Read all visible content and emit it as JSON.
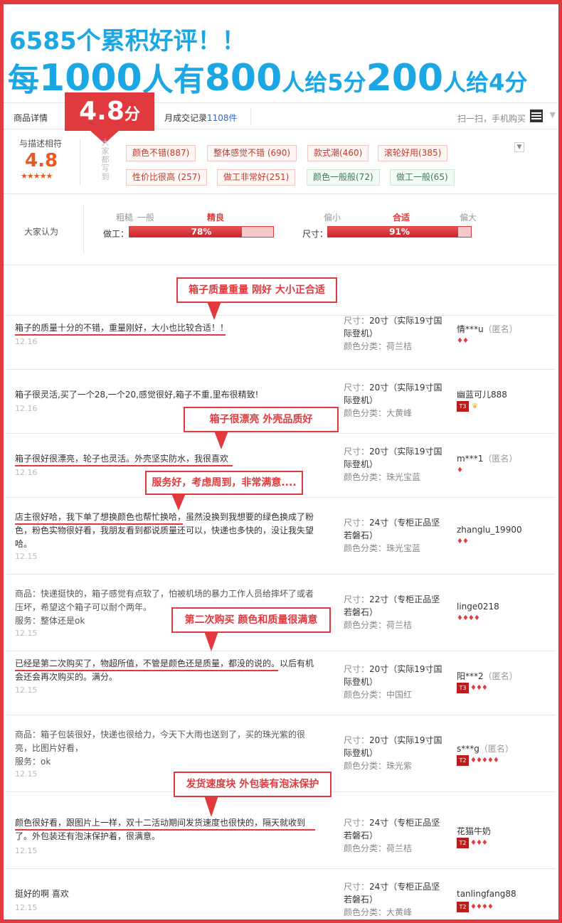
{
  "headline": {
    "line1": "6585个累积好评！！",
    "line2_a": "每",
    "line2_b": "1000",
    "line2_c": "人有",
    "line2_d": "800",
    "line2_e": "人给5分",
    "line2_f": "200",
    "line2_g": "人给4分"
  },
  "callout": {
    "value": "4.8",
    "unit": "分"
  },
  "tabs": {
    "detail": "商品详情",
    "record_label": "月成交记录",
    "record_count": "1108件",
    "scan": "扫一扫，手机购买"
  },
  "summary": {
    "label": "与描述相符",
    "score": "4.8",
    "stars": "★★★★★",
    "vertical_label": "大家都写到",
    "tags": [
      {
        "text": "颜色不错(887)",
        "tone": "red"
      },
      {
        "text": "整体感觉不错 (690)",
        "tone": "red"
      },
      {
        "text": "款式潮(460)",
        "tone": "red"
      },
      {
        "text": "滚轮好用(385)",
        "tone": "red"
      },
      {
        "text": "性价比很高 (257)",
        "tone": "red"
      },
      {
        "text": "做工非常好(251)",
        "tone": "red"
      },
      {
        "text": "颜色一般般(72)",
        "tone": "green"
      },
      {
        "text": "做工一般(65)",
        "tone": "green"
      }
    ]
  },
  "opinion": {
    "label": "大家认为",
    "workmanship": {
      "title": "做工：",
      "levels": [
        "粗糙",
        "一般",
        "精良"
      ],
      "active_level": "精良",
      "percent": 78,
      "percent_text": "78%"
    },
    "size": {
      "title": "尺寸：",
      "levels": [
        "偏小",
        "合适",
        "偏大"
      ],
      "active_level": "合适",
      "percent": 91,
      "percent_text": "91%"
    }
  },
  "notes": [
    {
      "text": "箱子质量重量 刚好 大小正合适"
    },
    {
      "text": "箱子很漂亮 外壳品质好"
    },
    {
      "text": "服务好，考虑周到，非常满意...."
    },
    {
      "text": "第二次购买  颜色和质量很满意"
    },
    {
      "text": "发货速度块 外包装有泡沫保护"
    }
  ],
  "sku_keys": {
    "size": "尺寸：",
    "color": "颜色分类："
  },
  "reviews": [
    {
      "text": "箱子的质量十分的不错，重量刚好，大小也比较合适！！",
      "date": "12.16",
      "size": "20寸（实际19寸国际登机）",
      "color": "荷兰桔",
      "user": "情***u",
      "anon": "（匿名）",
      "level": "",
      "gems": "♦♦",
      "crown": ""
    },
    {
      "text": "箱子很灵活,买了一个28,一个20,感觉很好,箱子不重,里布很精致!",
      "date": "12.16",
      "size": "20寸（实际19寸国际登机）",
      "color": "大黄峰",
      "user": "幽蓝可儿888",
      "anon": "",
      "level": "T3",
      "gems": "",
      "crown": "♛"
    },
    {
      "text": "箱子很好很漂亮，轮子也灵活。外壳坚实防水，我很喜欢",
      "date": "12.16",
      "size": "20寸（实际19寸国际登机）",
      "color": "珠光宝蓝",
      "user": "m***1",
      "anon": "（匿名）",
      "level": "",
      "gems": "♦",
      "crown": ""
    },
    {
      "text": "店主很好哈，我下单了想换颜色也帮忙换哈，虽然没换到我想要的绿色换成了粉色，粉色实物很好看，我朋友看到都说质量还可以，快递也多快的，没让我失望哈。",
      "date": "12.15",
      "size": "24寸（专柜正品坚若磐石）",
      "color": "珠光宝蓝",
      "user": "zhanglu_19900",
      "anon": "",
      "level": "",
      "gems": "♦♦",
      "crown": ""
    },
    {
      "text": "商品：快递挺快的，箱子感觉有点软了，怕被机场的暴力工作人员给摔坏了或者压坏，希望这个箱子可以耐个两年。",
      "text2": "服务：整体还是ok",
      "date": "12.15",
      "size": "22寸（专柜正品坚若磐石）",
      "color": "荷兰桔",
      "user": "linge0218",
      "anon": "",
      "level": "",
      "gems": "♦♦♦♦",
      "crown": ""
    },
    {
      "text": "已经是第二次购买了，物超所值，不管是颜色还是质量，都没的说的。以后有机会还会再次购买的。满分。",
      "date": "12.15",
      "size": "20寸（实际19寸国际登机）",
      "color": "中国红",
      "user": "阳***2",
      "anon": "（匿名）",
      "level": "T3",
      "gems": "♦♦♦",
      "crown": ""
    },
    {
      "text": "商品：箱子包装很好，快递也很给力，今天下大雨也送到了，买的珠光紫的很亮，比图片好看，",
      "text2": "服务：ok",
      "date": "12.15",
      "size": "20寸（实际19寸国际登机）",
      "color": "珠光紫",
      "user": "s***g",
      "anon": "（匿名）",
      "level": "T2",
      "gems": "♦♦♦♦♦",
      "crown": ""
    },
    {
      "text": "颜色很好看，跟图片上一样，双十二活动期间发货速度也很快的，隔天就收到了。外包装还有泡沫保护着，很满意。",
      "date": "12.15",
      "size": "24寸（专柜正品坚若磐石）",
      "color": "荷兰桔",
      "user": "花猫牛奶",
      "anon": "",
      "level": "T2",
      "gems": "♦♦♦",
      "crown": ""
    },
    {
      "text": "挺好的啊 喜欢",
      "date": "12.15",
      "size": "24寸（专柜正品坚若磐石）",
      "color": "大黄峰",
      "user": "tanlingfang88",
      "anon": "",
      "level": "T2",
      "gems": "♦♦♦♦",
      "crown": ""
    }
  ]
}
